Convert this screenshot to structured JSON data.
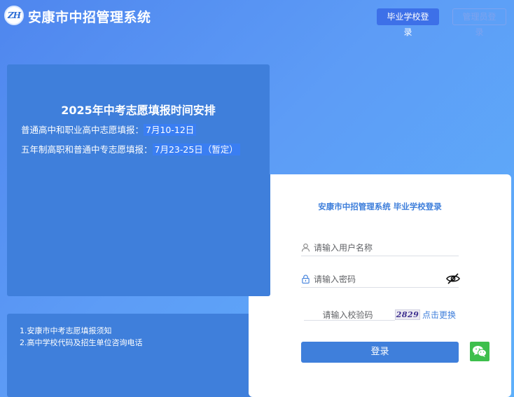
{
  "header": {
    "logo_text": "ZH",
    "app_title": "安康市中招管理系统",
    "school_login_label": "毕业学校登录",
    "admin_login_label": "管理员登录"
  },
  "notice": {
    "title": "2025年中考志愿填报时间安排",
    "items": [
      {
        "label": "普通高中和职业高中志愿填报：",
        "value": "7月10-12日"
      },
      {
        "label": "五年制高职和普通中专志愿填报：",
        "value": "7月23-25日（暂定）"
      }
    ]
  },
  "links": {
    "items": [
      {
        "label": "1.安康市中考志愿填报须知"
      },
      {
        "label": "2.高中学校代码及招生单位咨询电话"
      }
    ]
  },
  "login": {
    "title": "安康市中招管理系统 毕业学校登录",
    "username_placeholder": "请输入用户名称",
    "password_placeholder": "请输入密码",
    "captcha_placeholder": "请输入校验码",
    "captcha_code": "2829",
    "captcha_refresh_label": "点击更换",
    "submit_label": "登录"
  },
  "colors": {
    "accent": "#3f7fdb",
    "wechat": "#3dbf4c"
  },
  "icons": {
    "username": "user-icon",
    "password": "lock-icon",
    "toggle_password": "eye-slash-icon",
    "social": "wechat-icon"
  }
}
